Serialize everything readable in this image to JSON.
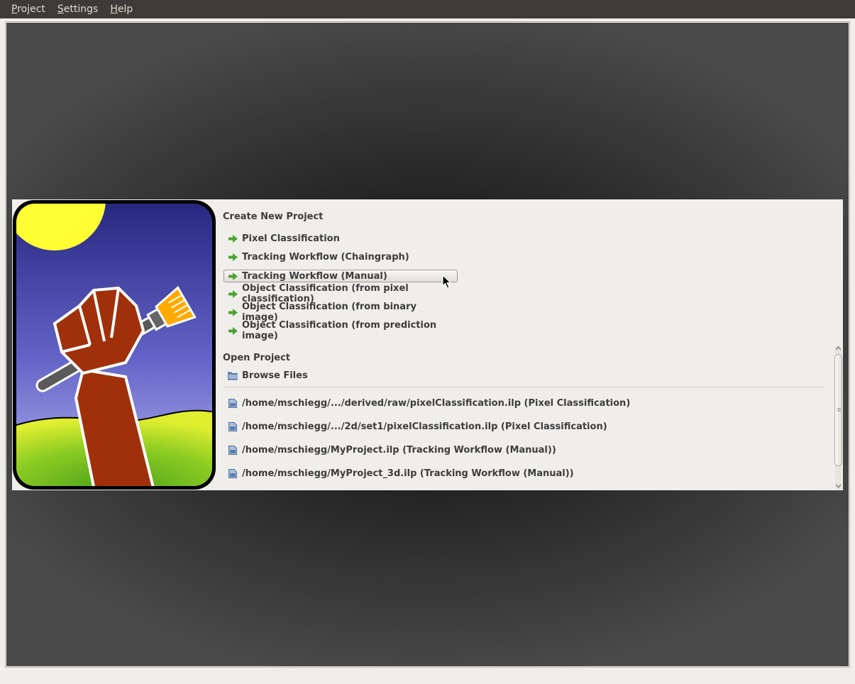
{
  "menubar": {
    "items": [
      {
        "mnemonic": "P",
        "rest": "roject"
      },
      {
        "mnemonic": "S",
        "rest": "ettings"
      },
      {
        "mnemonic": "H",
        "rest": "elp"
      }
    ]
  },
  "startup": {
    "create_title": "Create New Project",
    "workflows": [
      "Pixel Classification",
      "Tracking Workflow (Chaingraph)",
      "Tracking Workflow (Manual)",
      "Object Classification (from pixel classification)",
      "Object Classification (from binary image)",
      "Object Classification (from prediction image)"
    ],
    "hovered_workflow_index": 2,
    "open_title": "Open Project",
    "browse_label": "Browse Files",
    "recent_projects": [
      "/home/mschiegg/.../derived/raw/pixelClassification.ilp (Pixel Classification)",
      "/home/mschiegg/.../2d/set1/pixelClassification.ilp (Pixel Classification)",
      "/home/mschiegg/MyProject.ilp (Tracking Workflow (Manual))",
      "/home/mschiegg/MyProject_3d.ilp (Tracking Workflow (Manual))"
    ]
  },
  "colors": {
    "menubar_bg": "#3c3b37",
    "menubar_text": "#dfdbd2",
    "panel_bg": "#f0eeeb",
    "arrow_green": "#4ea22f",
    "logo_arm": "#a0300a",
    "logo_sun": "#ffff33",
    "logo_sky_top": "#2a2a8a",
    "logo_sky_bottom": "#a5a5ee",
    "logo_grass": "#7ac420",
    "logo_brush": "#ffaa00"
  },
  "icons": {
    "workflow_item": "green-arrow-icon",
    "browse": "folder-icon",
    "recent_item": "project-file-icon",
    "logo": "ilastik-fist-paintbrush-logo"
  }
}
